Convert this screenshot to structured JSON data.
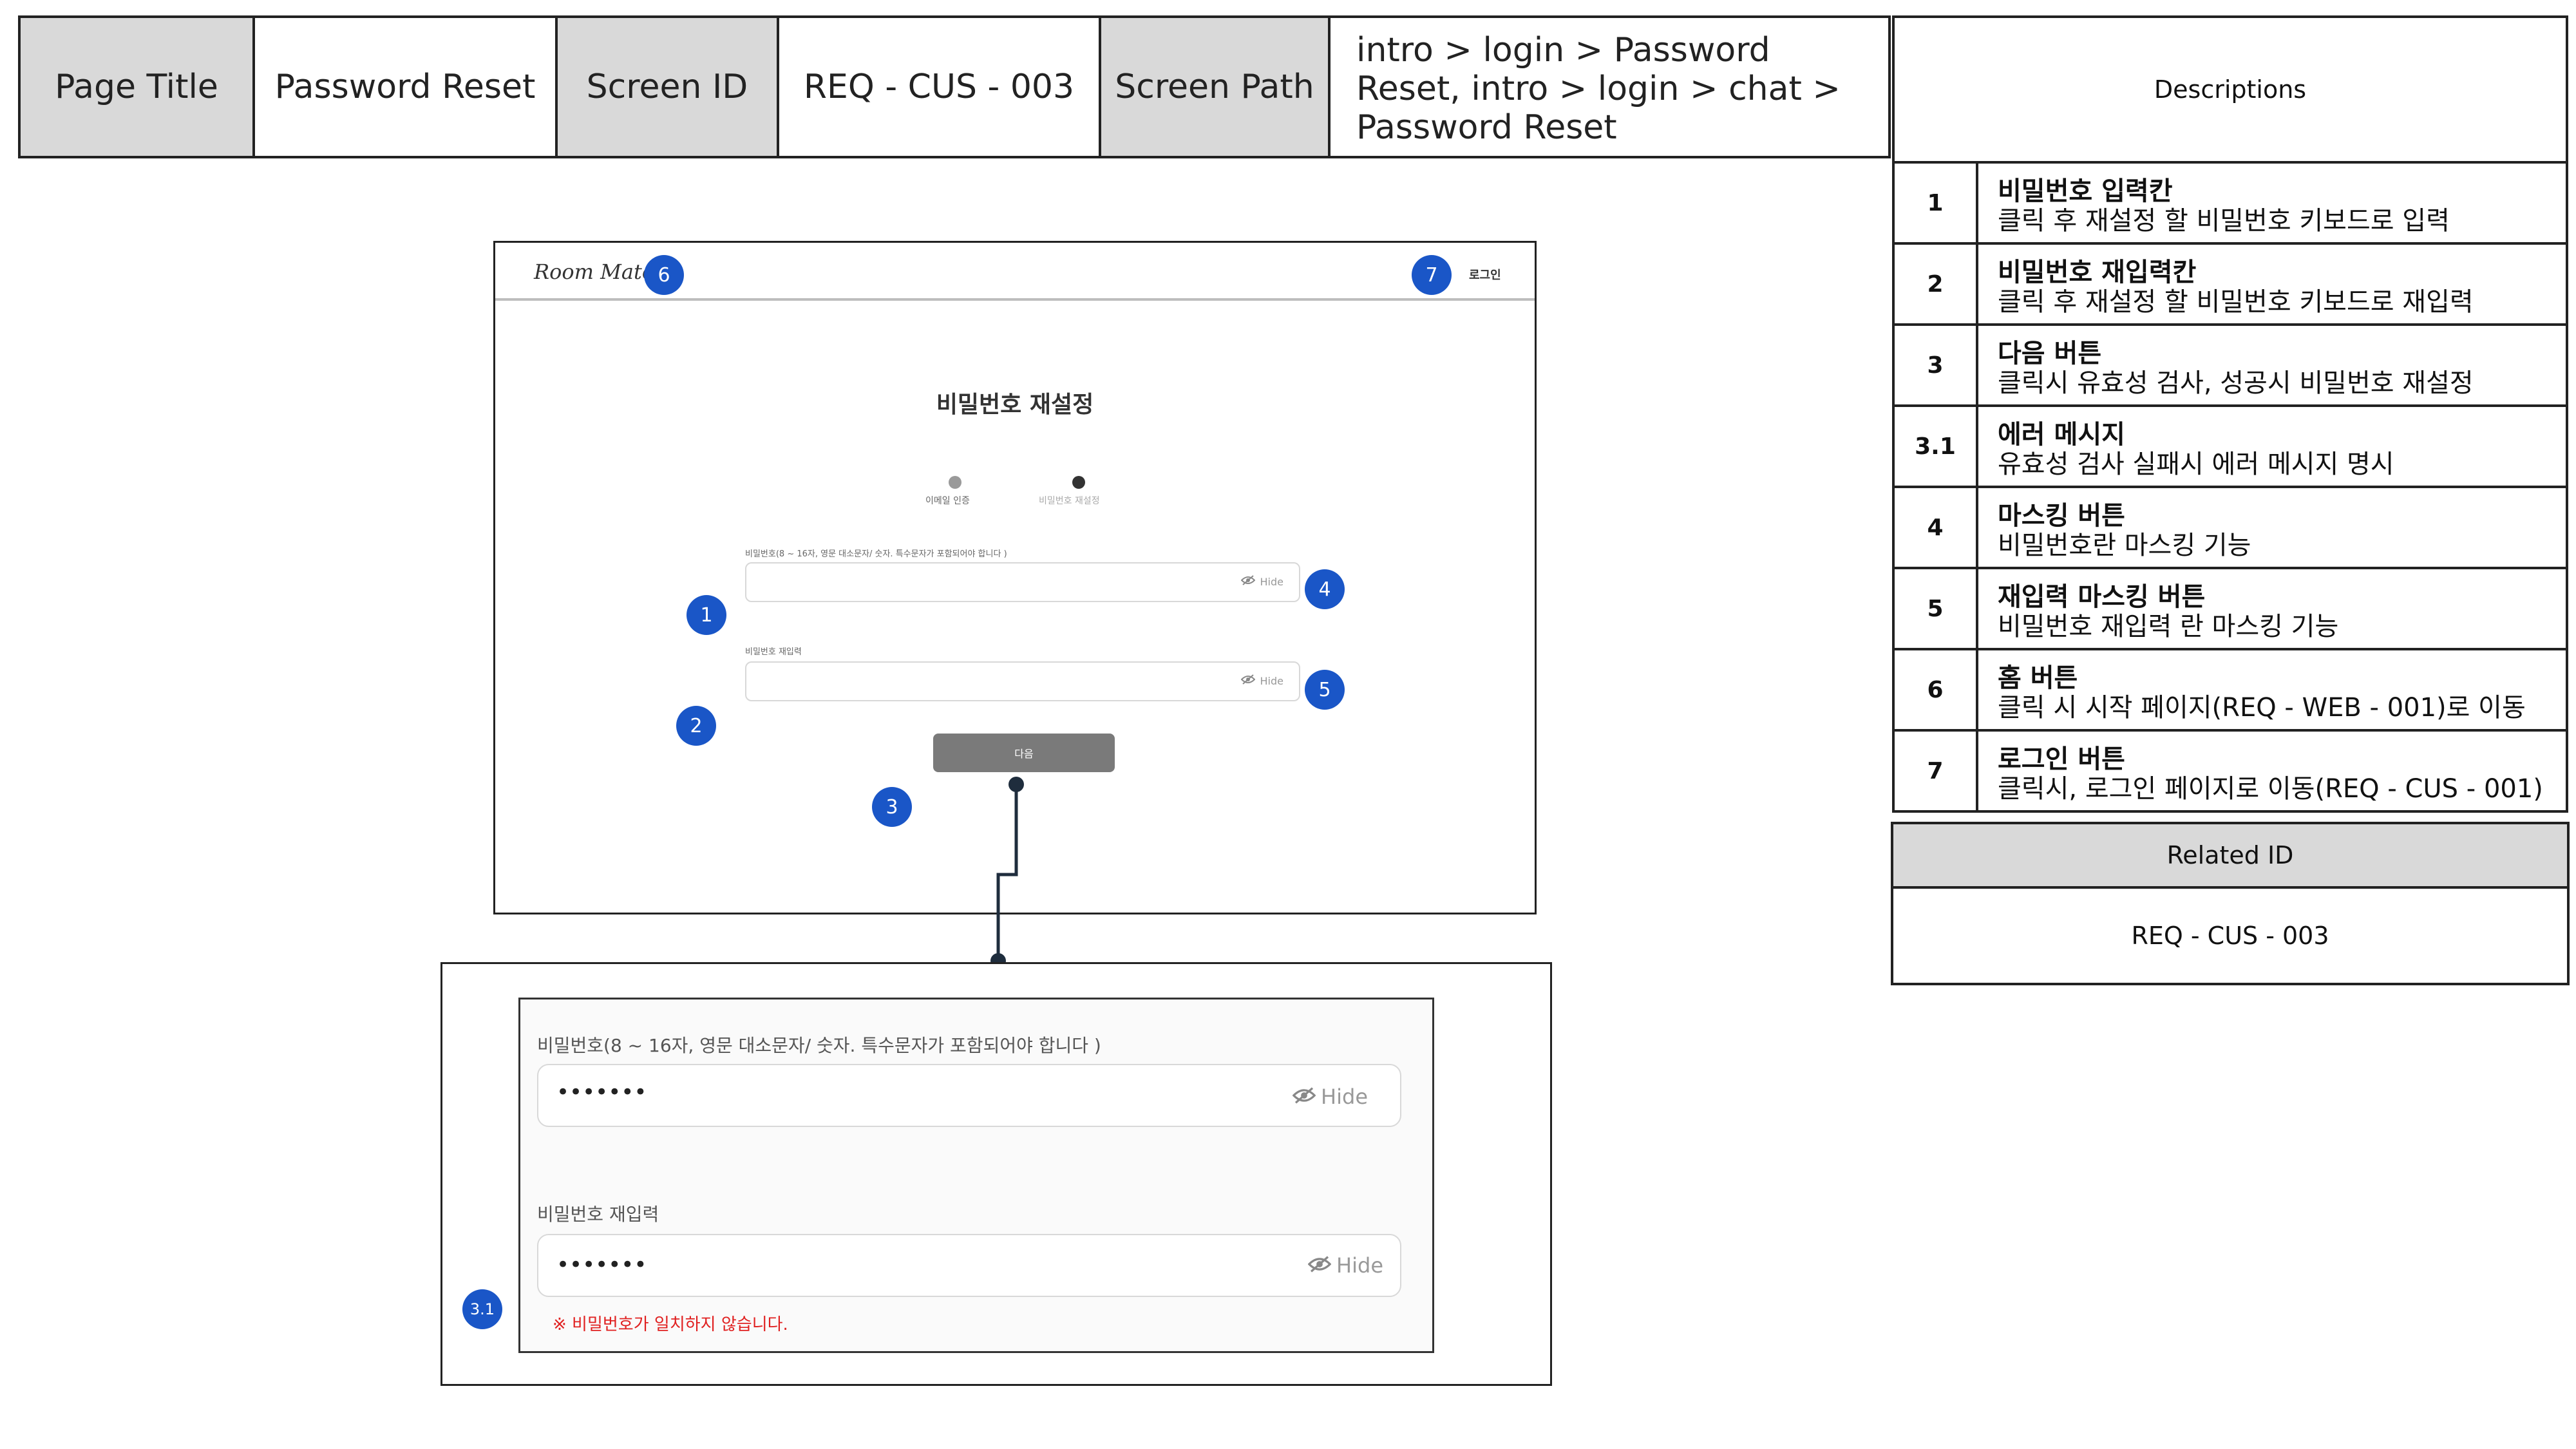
{
  "header": {
    "page_title_label": "Page Title",
    "page_title_value": "Password Reset",
    "screen_id_label": "Screen ID",
    "screen_id_value": "REQ - CUS - 003",
    "screen_path_label": "Screen Path",
    "screen_path_value": "intro > login > Password Reset, intro > login > chat > Password Reset"
  },
  "descriptions": {
    "title": "Descriptions",
    "items": [
      {
        "num": "1",
        "title": "비밀번호 입력칸",
        "desc": "클릭 후 재설정 할 비밀번호 키보드로 입력"
      },
      {
        "num": "2",
        "title": "비밀번호 재입력칸",
        "desc": "클릭 후 재설정 할 비밀번호 키보드로 재입력"
      },
      {
        "num": "3",
        "title": "다음 버튼",
        "desc": "클릭시 유효성 검사, 성공시 비밀번호 재설정"
      },
      {
        "num": "3.1",
        "title": "에러 메시지",
        "desc": "유효성 검사 실패시 에러 메시지 명시"
      },
      {
        "num": "4",
        "title": "마스킹 버튼",
        "desc": "비밀번호란 마스킹 기능"
      },
      {
        "num": "5",
        "title": "재입력 마스킹 버튼",
        "desc": "비밀번호 재입력 란 마스킹 기능"
      },
      {
        "num": "6",
        "title": "홈 버튼",
        "desc": "클릭 시 시작 페이지(REQ - WEB - 001)로 이동"
      },
      {
        "num": "7",
        "title": "로그인 버튼",
        "desc": "클릭시, 로그인 페이지로 이동(REQ - CUS - 001)"
      }
    ]
  },
  "related": {
    "label": "Related ID",
    "value": "REQ - CUS - 003"
  },
  "mockup": {
    "logo": "Room Mate",
    "login_link": "로그인",
    "heading": "비밀번호 재설정",
    "step1_label": "이메일 인증",
    "step2_label": "비밀번호 재설정",
    "password_label": "비밀번호(8 ~ 16자, 영문 대소문자/ 숫자. 특수문자가 포함되어야 합니다 )",
    "confirm_label": "비밀번호 재입력",
    "hide_label": "Hide",
    "next_button": "다음"
  },
  "error_detail": {
    "password_label": "비밀번호(8 ~ 16자, 영문 대소문자/ 숫자. 특수문자가 포함되어야 합니다 )",
    "password_value": "•••••••",
    "confirm_label": "비밀번호 재입력",
    "confirm_value": "•••••••",
    "hide_label": "Hide",
    "error_message": "※ 비밀번호가 일치하지 않습니다."
  },
  "badges": {
    "b1": "1",
    "b2": "2",
    "b3": "3",
    "b4": "4",
    "b5": "5",
    "b6": "6",
    "b7": "7",
    "b31": "3.1"
  },
  "colors": {
    "badge": "#1a56c7",
    "header_gray": "#d9d9d9",
    "error_red": "#e02020",
    "button_gray": "#7a7a7a"
  }
}
